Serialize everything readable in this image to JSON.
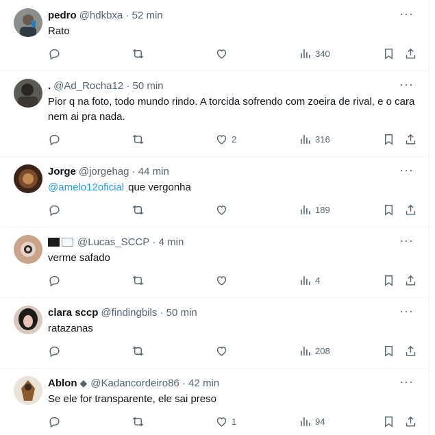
{
  "colors": {
    "text": "#0f1419",
    "secondary": "#536471",
    "mention": "#1d9bf0",
    "divider": "#eff3f4"
  },
  "icons": {
    "more": "more-icon",
    "reply": "reply-icon",
    "retweet": "retweet-icon",
    "like": "like-icon",
    "views": "views-icon",
    "bookmark": "bookmark-icon",
    "share": "share-icon"
  },
  "more_glyph": "···",
  "tweets": [
    {
      "name": "pedro",
      "handle": "@hdkbxa",
      "time": "· 52 min",
      "text": "Rato",
      "mention": "",
      "likes": "",
      "views": "340"
    },
    {
      "name": ".",
      "handle": "@Ad_Rocha12",
      "time": "· 50 min",
      "text": "Pior q na foto, todo mundo rindo. A torcida sofrendo com zoeira de rival, e o cara nem ai pra nada.",
      "mention": "",
      "likes": "2",
      "views": "316"
    },
    {
      "name": "Jorge",
      "handle": "@jorgehag",
      "time": "· 44 min",
      "text": "que vergonha",
      "mention": "@amelo12oficial",
      "likes": "",
      "views": "189"
    },
    {
      "name": "",
      "handle": "@Lucas_SCCP",
      "time": "· 4 min",
      "text": "verme safado",
      "mention": "",
      "likes": "",
      "views": "4"
    },
    {
      "name": "clara sccp",
      "handle": "@findingbils",
      "time": "· 50 min",
      "text": "ratazanas",
      "mention": "",
      "likes": "",
      "views": "208"
    },
    {
      "name": "Ablon",
      "handle": "@Kadancordeiro86",
      "time": "· 42 min",
      "text": "Se ele for transparente, ele sai preso",
      "mention": "",
      "likes": "1",
      "views": "94"
    }
  ]
}
